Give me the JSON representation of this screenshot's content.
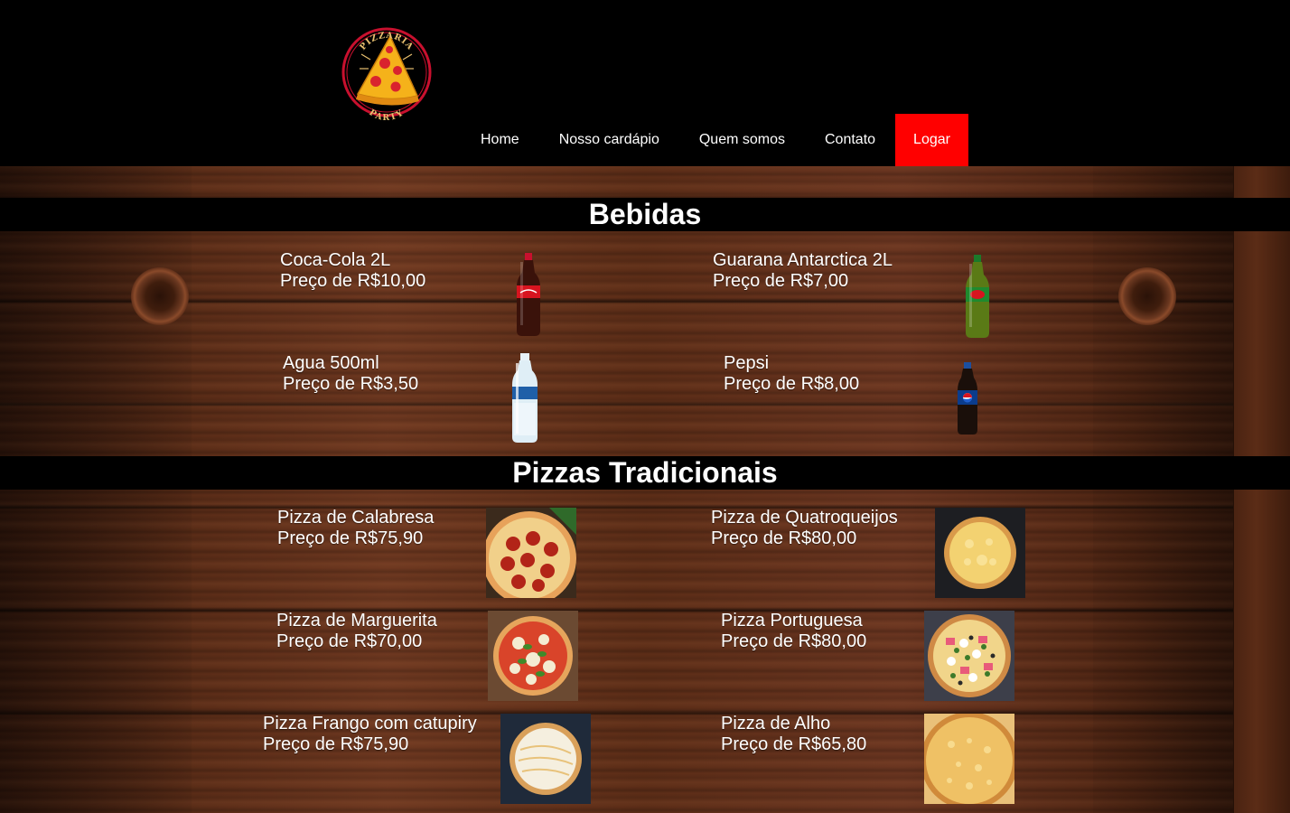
{
  "header": {
    "logo": {
      "top_text": "PIZZARIA",
      "bottom_text": "PARTY",
      "icon": "pizza-slice-icon"
    },
    "nav": {
      "home": "Home",
      "menu": "Nosso cardápio",
      "about": "Quem somos",
      "contact": "Contato",
      "login": "Logar"
    },
    "colors": {
      "login_bg": "#ff0000",
      "header_bg": "#000000"
    }
  },
  "sections": {
    "drinks": {
      "title": "Bebidas",
      "items": [
        {
          "name": "Coca-Cola 2L",
          "price": "Preço de R$10,00",
          "image": "coca-cola-bottle"
        },
        {
          "name": "Guarana Antarctica 2L",
          "price": "Preço de R$7,00",
          "image": "guarana-bottle"
        },
        {
          "name": "Agua 500ml",
          "price": "Preço de R$3,50",
          "image": "water-bottle"
        },
        {
          "name": "Pepsi",
          "price": "Preço de R$8,00",
          "image": "pepsi-bottle"
        }
      ]
    },
    "pizzas": {
      "title": "Pizzas Tradicionais",
      "items": [
        {
          "name": "Pizza de Calabresa",
          "price": "Preço de R$75,90",
          "image": "pizza-calabresa"
        },
        {
          "name": "Pizza de Quatroqueijos",
          "price": "Preço de R$80,00",
          "image": "pizza-quatro-queijos"
        },
        {
          "name": "Pizza de Marguerita",
          "price": "Preço de R$70,00",
          "image": "pizza-marguerita"
        },
        {
          "name": "Pizza Portuguesa",
          "price": "Preço de R$80,00",
          "image": "pizza-portuguesa"
        },
        {
          "name": "Pizza Frango com catupiry",
          "price": "Preço de R$75,90",
          "image": "pizza-frango-catupiry"
        },
        {
          "name": "Pizza de Alho",
          "price": "Preço de R$65,80",
          "image": "pizza-alho"
        }
      ]
    }
  }
}
